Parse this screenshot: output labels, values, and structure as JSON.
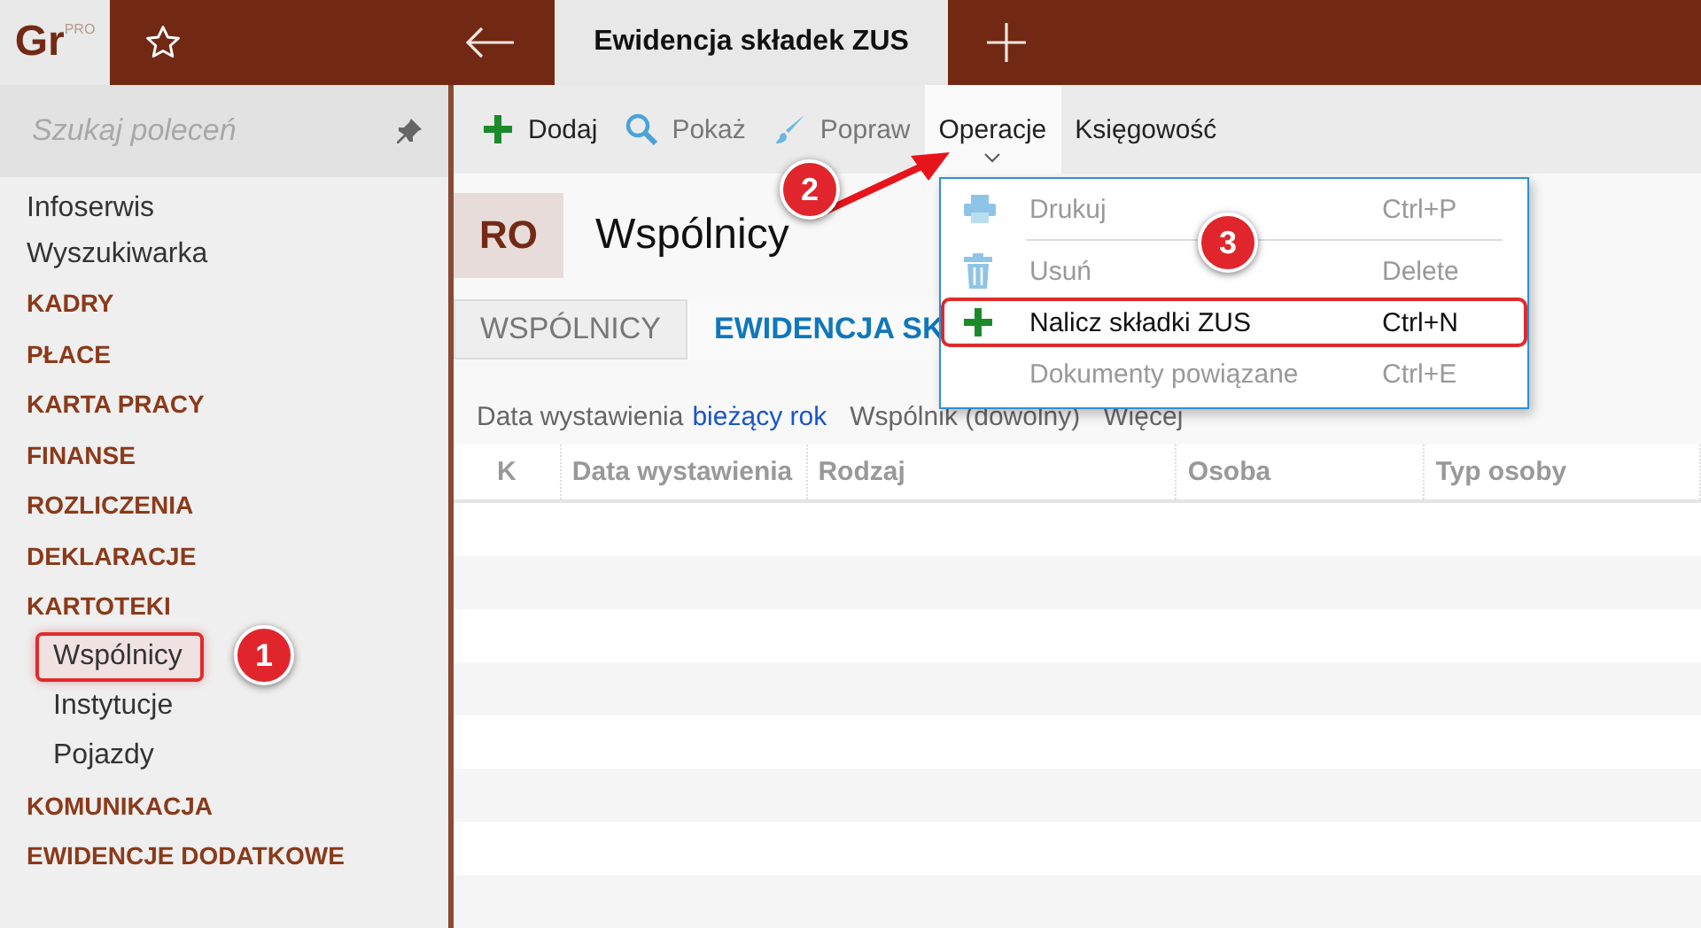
{
  "app": {
    "logo": "Gr",
    "logo_badge": "PRO"
  },
  "tabs": [
    {
      "label": "Ewidencja składek ZUS",
      "selected": true
    }
  ],
  "sidebar": {
    "search": {
      "placeholder": "Szukaj poleceń"
    },
    "items": [
      {
        "label": "Infoserwis",
        "kind": "link"
      },
      {
        "label": "Wyszukiwarka",
        "kind": "link"
      },
      {
        "label": "KADRY",
        "kind": "category"
      },
      {
        "label": "PŁACE",
        "kind": "category"
      },
      {
        "label": "KARTA PRACY",
        "kind": "category"
      },
      {
        "label": "FINANSE",
        "kind": "category"
      },
      {
        "label": "ROZLICZENIA",
        "kind": "category"
      },
      {
        "label": "DEKLARACJE",
        "kind": "category"
      },
      {
        "label": "KARTOTEKI",
        "kind": "category",
        "children": [
          {
            "label": "Wspólnicy",
            "highlighted": true
          },
          {
            "label": "Instytucje",
            "highlighted": false
          },
          {
            "label": "Pojazdy",
            "highlighted": false
          }
        ]
      },
      {
        "label": "KOMUNIKACJA",
        "kind": "category"
      },
      {
        "label": "EWIDENCJE DODATKOWE",
        "kind": "category"
      }
    ]
  },
  "toolbar": [
    {
      "label": "Dodaj",
      "kind": "add",
      "disabled": false,
      "expanded": false
    },
    {
      "label": "Pokaż",
      "kind": "search",
      "disabled": true,
      "expanded": false
    },
    {
      "label": "Popraw",
      "kind": "edit",
      "disabled": true,
      "expanded": false
    },
    {
      "label": "Operacje",
      "kind": "menu",
      "disabled": false,
      "expanded": true
    },
    {
      "label": "Księgowość",
      "kind": "menu",
      "disabled": false,
      "expanded": false
    }
  ],
  "header": {
    "badge": "RO",
    "title": "Wspólnicy"
  },
  "view_tabs": [
    {
      "label": "WSPÓLNICY",
      "selected": false
    },
    {
      "label": "EWIDENCJA SK",
      "selected": true
    }
  ],
  "filters": [
    {
      "label": "Data wystawienia",
      "value": "bieżący rok"
    },
    {
      "label": "Wspólnik (dowolny)"
    },
    {
      "label": "Więcej"
    }
  ],
  "table": {
    "columns": [
      "K",
      "Data wystawienia",
      "Rodzaj",
      "Osoba",
      "Typ osoby"
    ]
  },
  "menu": {
    "items": [
      {
        "label": "Drukuj",
        "shortcut": "Ctrl+P",
        "kind": "print",
        "disabled": true,
        "highlighted": false,
        "separator_after": true
      },
      {
        "label": "Usuń",
        "shortcut": "Delete",
        "kind": "delete",
        "disabled": true,
        "highlighted": false,
        "separator_after": false
      },
      {
        "label": "Nalicz składki ZUS",
        "shortcut": "Ctrl+N",
        "kind": "add",
        "disabled": false,
        "highlighted": true,
        "separator_after": false
      },
      {
        "label": "Dokumenty powiązane",
        "shortcut": "Ctrl+E",
        "kind": "none",
        "disabled": true,
        "highlighted": false,
        "separator_after": false
      }
    ]
  },
  "callouts": [
    "1",
    "2",
    "3"
  ]
}
